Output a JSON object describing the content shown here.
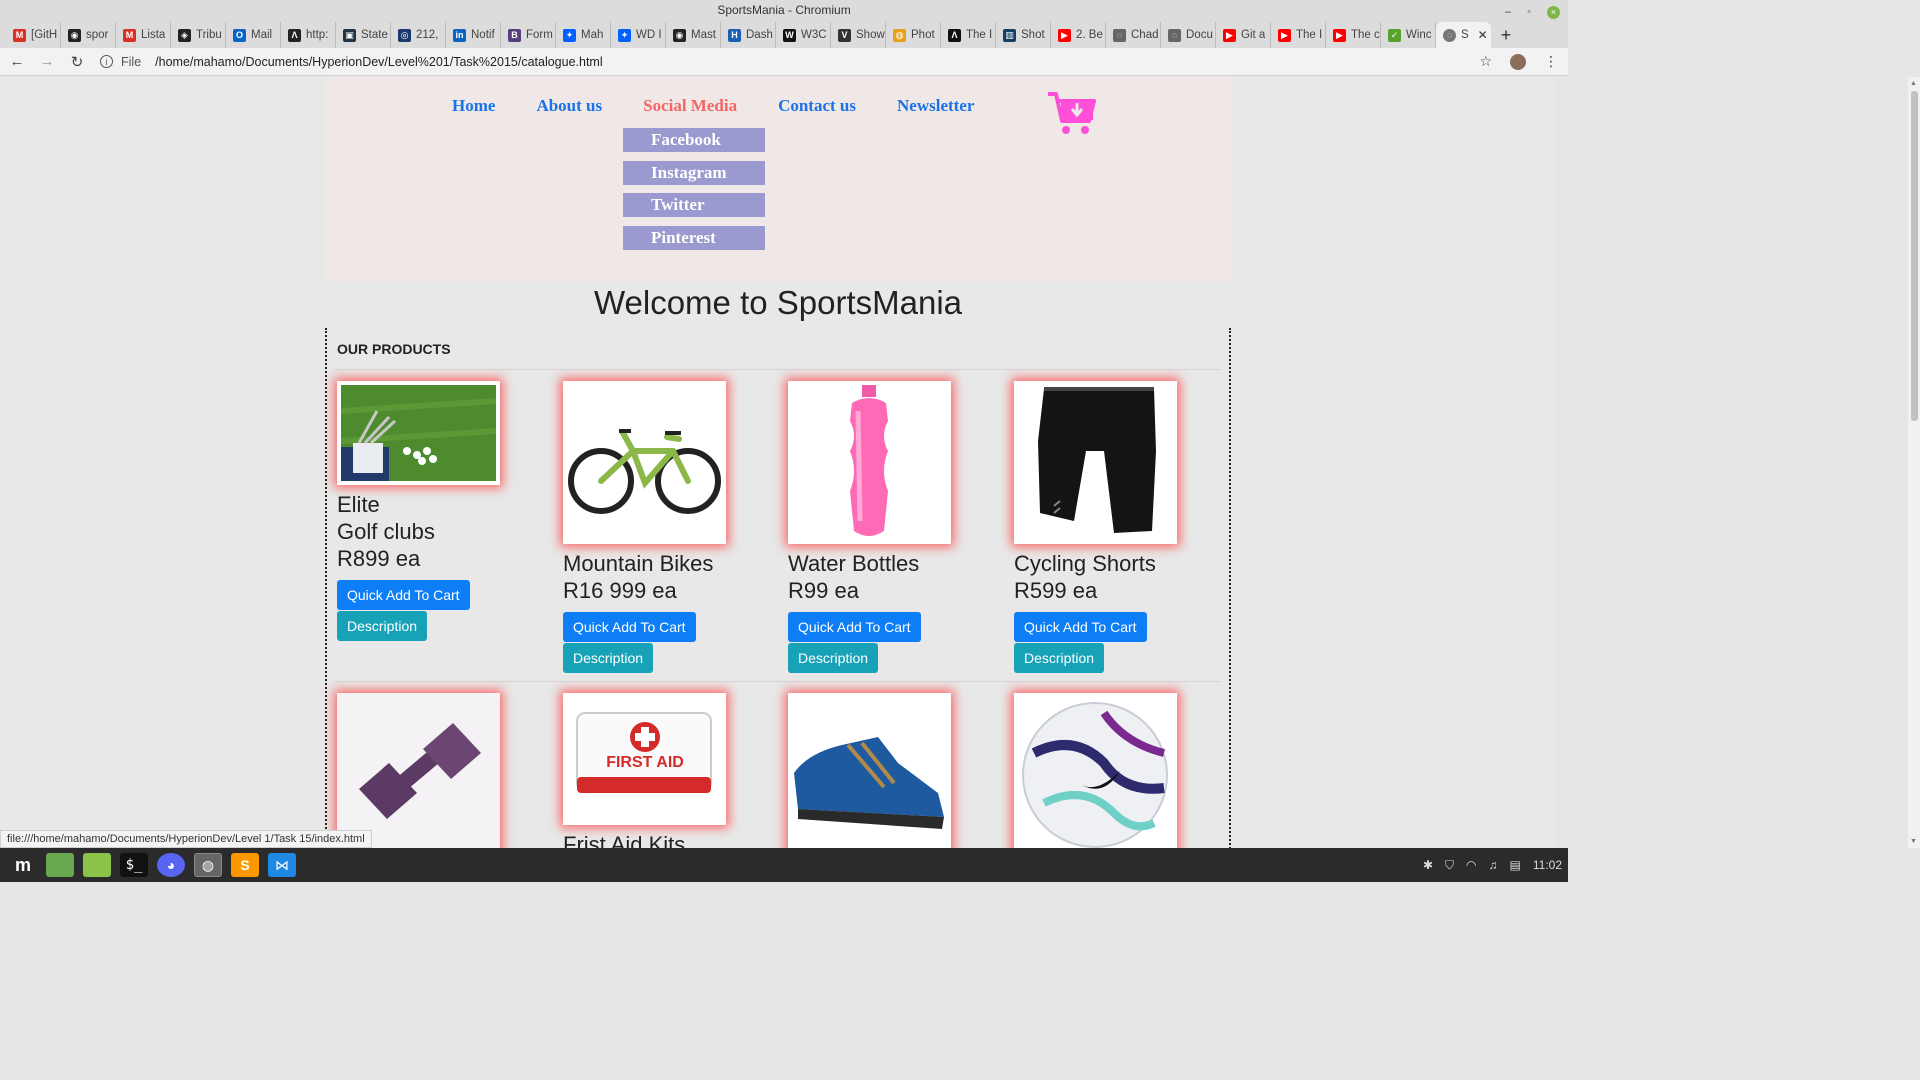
{
  "window": {
    "title": "SportsMania - Chromium"
  },
  "tabs": [
    {
      "label": "[GitH",
      "icon": "gmail-icon",
      "color": "#d93025",
      "glyph": "M"
    },
    {
      "label": "spor",
      "icon": "github-icon",
      "color": "#222",
      "glyph": "◉"
    },
    {
      "label": "Lista",
      "icon": "gmail-icon",
      "color": "#d93025",
      "glyph": "M"
    },
    {
      "label": "Tribu",
      "icon": "tribute-icon",
      "color": "#222",
      "glyph": "◈"
    },
    {
      "label": "Mail",
      "icon": "outlook-icon",
      "color": "#0a64c9",
      "glyph": "O"
    },
    {
      "label": "http:",
      "icon": "app-icon",
      "color": "#222",
      "glyph": "Λ"
    },
    {
      "label": "State",
      "icon": "app-icon",
      "color": "#234",
      "glyph": "▣"
    },
    {
      "label": "212,",
      "icon": "app-icon",
      "color": "#1b3a6b",
      "glyph": "◎"
    },
    {
      "label": "Notif",
      "icon": "linkedin-icon",
      "color": "#0a66c2",
      "glyph": "in"
    },
    {
      "label": "Form",
      "icon": "bootstrap-icon",
      "color": "#563d7c",
      "glyph": "B"
    },
    {
      "label": "Mah",
      "icon": "dropbox-icon",
      "color": "#0061fe",
      "glyph": "✦"
    },
    {
      "label": "WD I",
      "icon": "dropbox-icon",
      "color": "#0061fe",
      "glyph": "✦"
    },
    {
      "label": "Mast",
      "icon": "github-icon",
      "color": "#222",
      "glyph": "◉"
    },
    {
      "label": "Dash",
      "icon": "app-icon",
      "color": "#1a5fb4",
      "glyph": "H"
    },
    {
      "label": "W3C",
      "icon": "app-icon",
      "color": "#111",
      "glyph": "W"
    },
    {
      "label": "Show",
      "icon": "app-icon",
      "color": "#333",
      "glyph": "V"
    },
    {
      "label": "Phot",
      "icon": "chrome-icon",
      "color": "#e8a01a",
      "glyph": "◍"
    },
    {
      "label": "The I",
      "icon": "app-icon",
      "color": "#111",
      "glyph": "Λ"
    },
    {
      "label": "Shot",
      "icon": "app-icon",
      "color": "#163d66",
      "glyph": "▥"
    },
    {
      "label": "2. Be",
      "icon": "youtube-icon",
      "color": "#ff0000",
      "glyph": "▶"
    },
    {
      "label": "Chad",
      "icon": "globe-icon",
      "color": "#666",
      "glyph": "◌"
    },
    {
      "label": "Docu",
      "icon": "globe-icon",
      "color": "#666",
      "glyph": "◌"
    },
    {
      "label": "Git a",
      "icon": "youtube-icon",
      "color": "#ff0000",
      "glyph": "▶"
    },
    {
      "label": "The I",
      "icon": "youtube-icon",
      "color": "#ff0000",
      "glyph": "▶"
    },
    {
      "label": "The c",
      "icon": "youtube-icon",
      "color": "#ff0000",
      "glyph": "▶"
    },
    {
      "label": "Winc",
      "icon": "app-icon",
      "color": "#5aa02c",
      "glyph": "✓"
    }
  ],
  "active_tab": {
    "label": "S"
  },
  "address": {
    "scheme": "File",
    "url": "/home/mahamo/Documents/HyperionDev/Level%201/Task%2015/catalogue.html"
  },
  "site": {
    "nav": [
      {
        "label": "Home"
      },
      {
        "label": "About us"
      },
      {
        "label": "Social Media"
      },
      {
        "label": "Contact us"
      },
      {
        "label": "Newsletter"
      }
    ],
    "dropdown": [
      {
        "label": "Facebook"
      },
      {
        "label": "Instagram"
      },
      {
        "label": "Twitter"
      },
      {
        "label": "Pinterest"
      }
    ],
    "welcome": "Welcome to SportsMania",
    "products_title": "OUR PRODUCTS",
    "add_label": "Quick Add To Cart",
    "desc_label": "Description",
    "products": [
      {
        "name": "Elite",
        "name2": "Golf clubs",
        "price": "R899 ea"
      },
      {
        "name": "Mountain Bikes",
        "price": "R16 999 ea"
      },
      {
        "name": "Water Bottles",
        "price": "R99 ea"
      },
      {
        "name": "Cycling Shorts",
        "price": "R599 ea"
      },
      {
        "name": ""
      },
      {
        "name": "Frist Aid Kits"
      },
      {
        "name": ""
      },
      {
        "name": ""
      }
    ],
    "first_aid_label": "FIRST AID"
  },
  "status": {
    "url": "file:///home/mahamo/Documents/HyperionDev/Level 1/Task 15/index.html"
  },
  "clock": "11:02",
  "colors": {
    "nav_link": "#1a73e8",
    "nav_hover": "#f56565",
    "dropdown": "#9a9ad0",
    "cart": "#ff4fd8",
    "btn_blue": "#0d7ef6",
    "btn_teal": "#17a2b8"
  }
}
